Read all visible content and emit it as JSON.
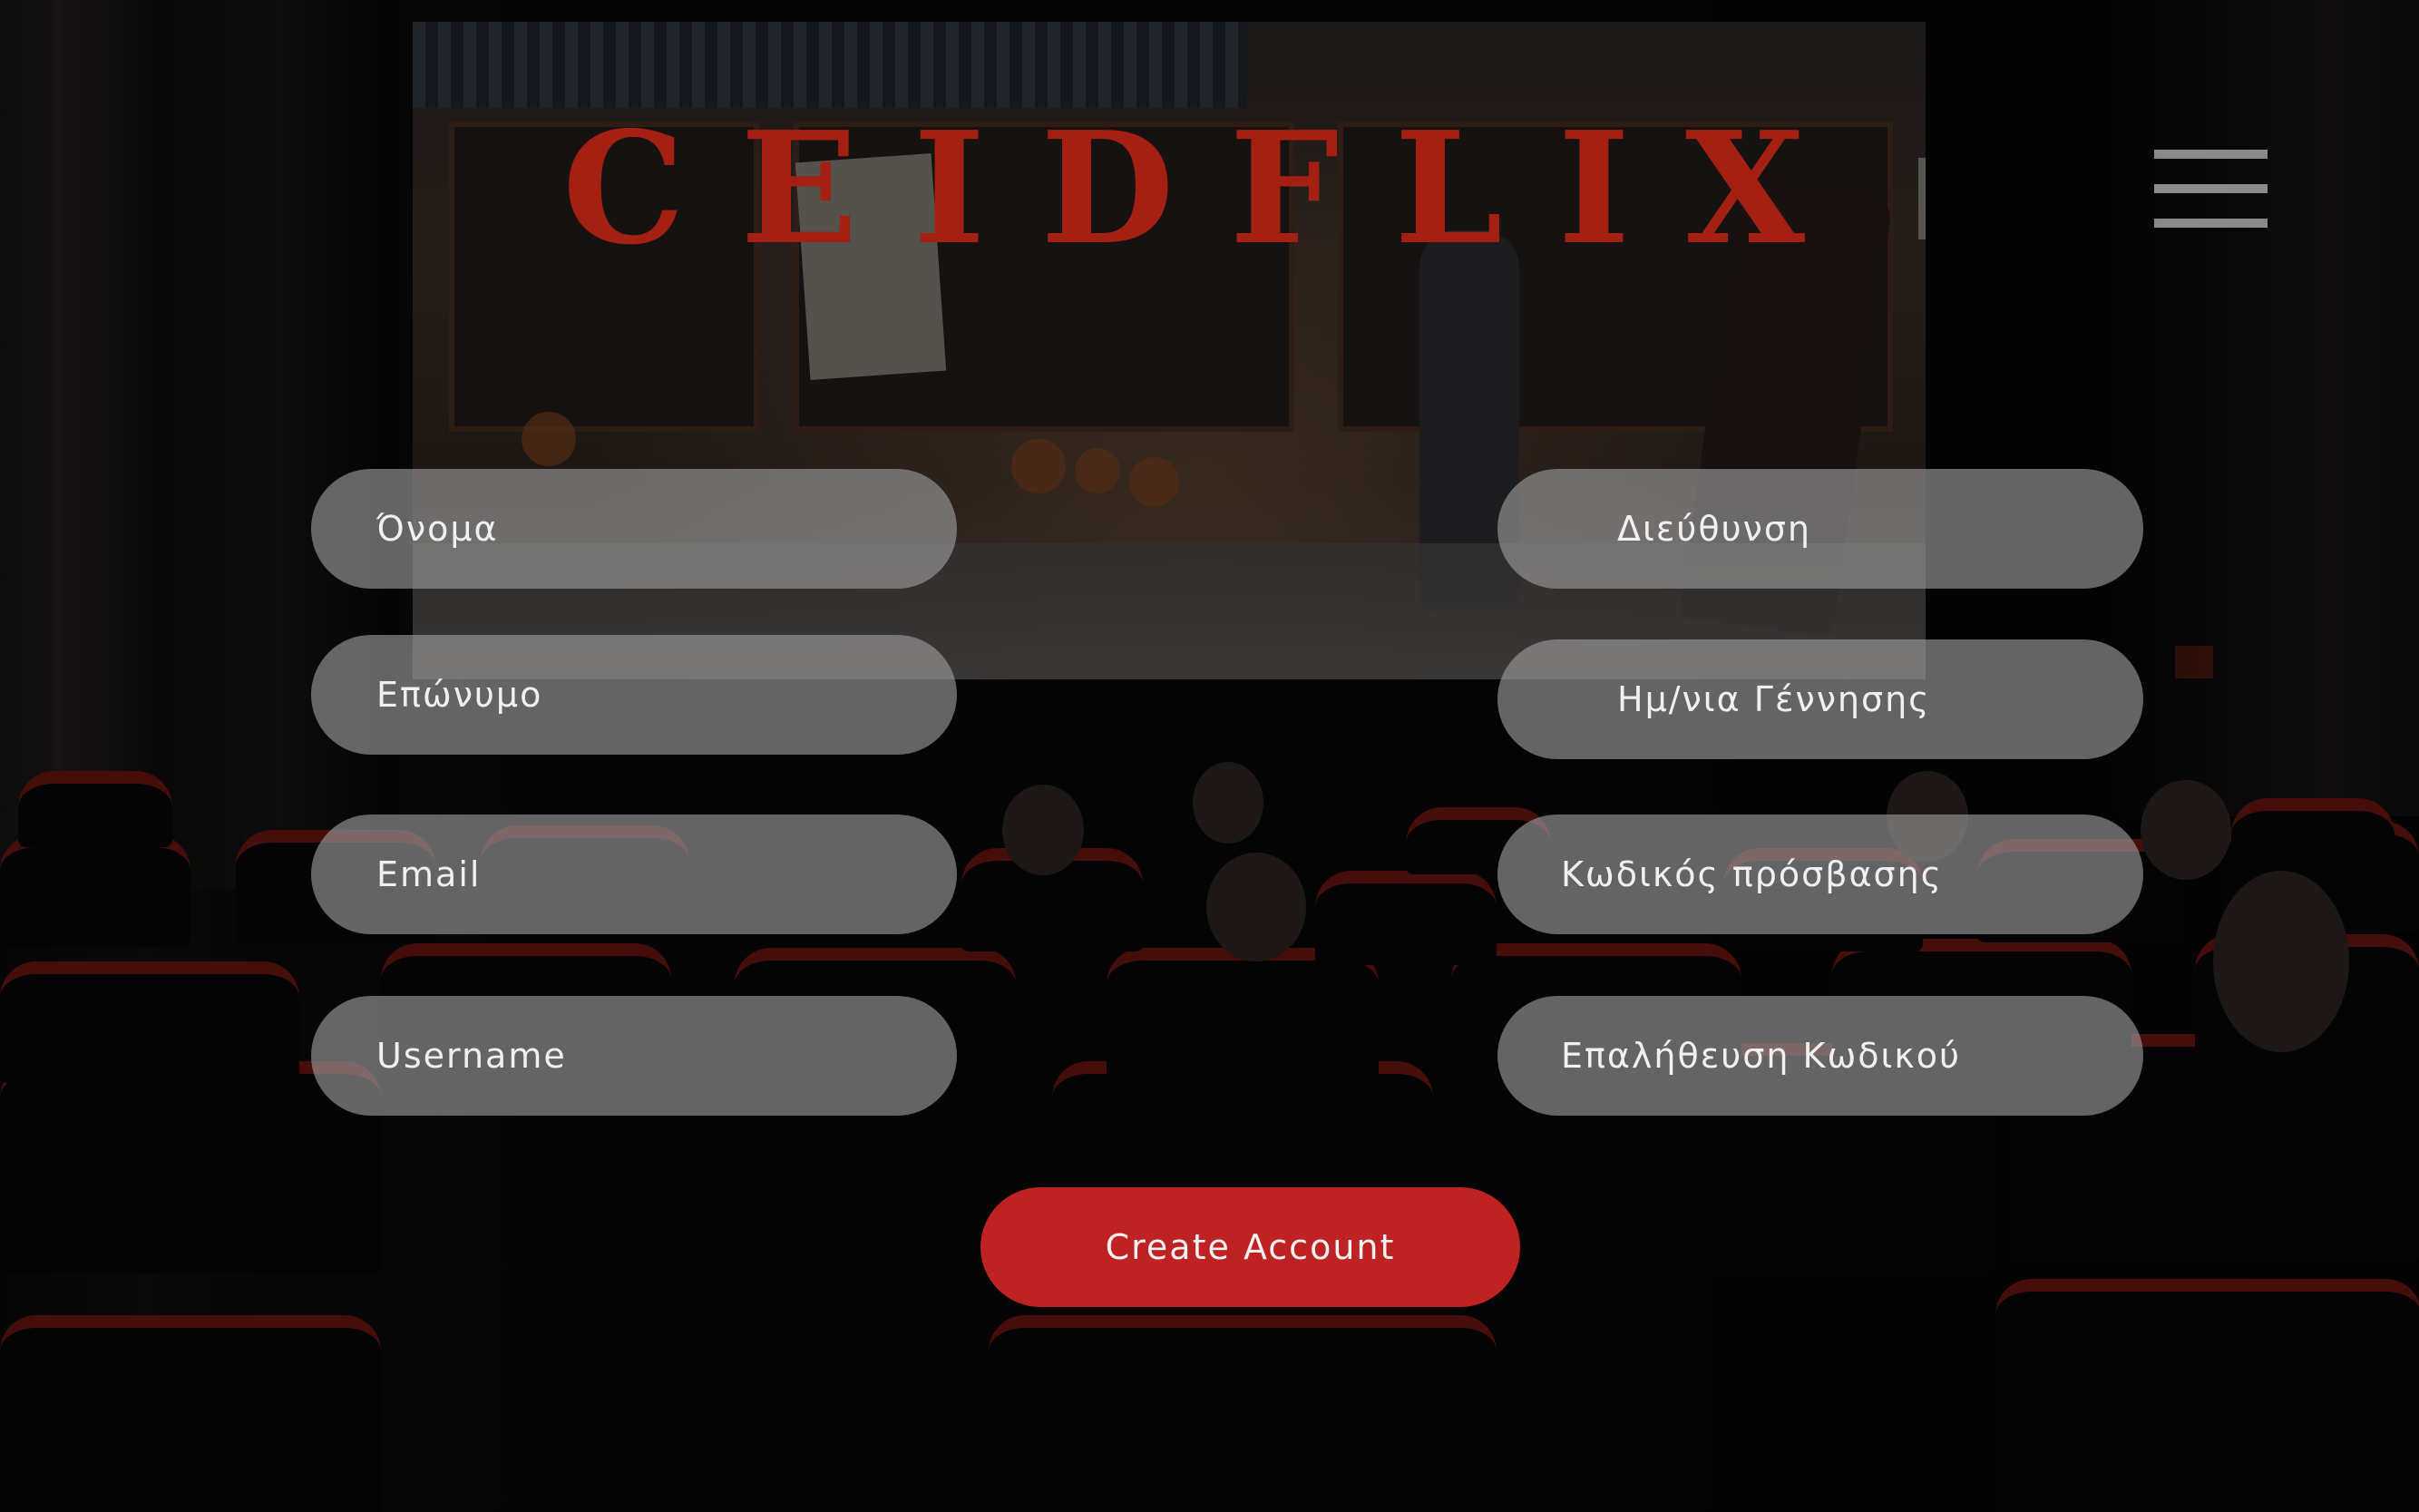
{
  "brand": {
    "letters": [
      "C",
      "E",
      "I",
      "D",
      "F",
      "L",
      "I",
      "X"
    ],
    "color": "#a32012"
  },
  "header": {
    "menu_icon": "hamburger-menu-icon"
  },
  "form": {
    "left_fields": {
      "first_name_placeholder": "Όνομα",
      "last_name_placeholder": "Επώνυμο",
      "email_placeholder": "Email",
      "username_placeholder": "Username"
    },
    "right_fields": {
      "address_placeholder": "Διεύθυνση",
      "birthdate_placeholder": "Ημ/νια Γέννησης",
      "password_placeholder": "Κωδικός πρόσβασης",
      "confirm_password_placeholder": "Επαλήθευση Κωδικού"
    },
    "submit_label": "Create Account",
    "submit_color": "#be2223"
  }
}
